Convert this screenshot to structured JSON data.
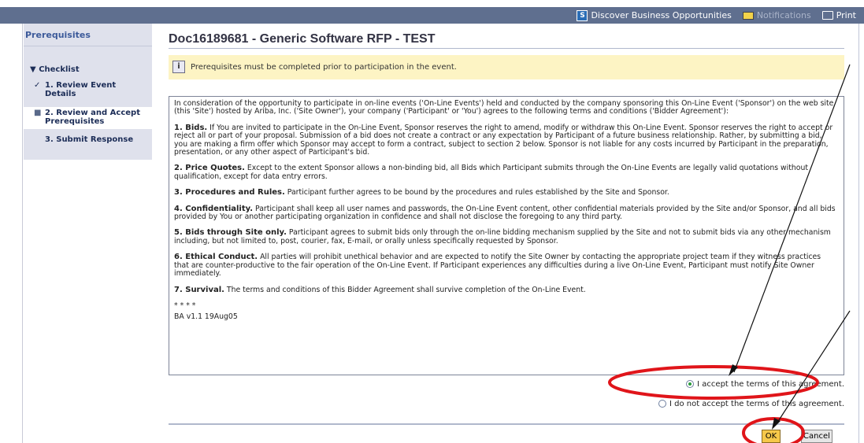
{
  "header": {
    "links": [
      {
        "icon": "business-icon",
        "label": "Discover Business Opportunities"
      },
      {
        "icon": "envelope-icon",
        "label": "Notifications"
      },
      {
        "icon": "printer-icon",
        "label": "Print"
      }
    ]
  },
  "sidebar": {
    "title": "Prerequisites",
    "checklist_label": "Checklist",
    "items": [
      {
        "mark": "✓",
        "label": "1. Review Event Details"
      },
      {
        "mark": "■",
        "label": "2. Review and Accept Prerequisites"
      },
      {
        "mark": "",
        "label": "3. Submit Response"
      }
    ]
  },
  "page": {
    "title": "Doc16189681 - Generic Software RFP - TEST",
    "notice": "Prerequisites must be completed prior to participation in the event."
  },
  "agreement": {
    "intro": "In consideration of the opportunity to participate in on-line events ('On-Line Events') held and conducted by the company sponsoring this On-Line Event ('Sponsor') on the web site (this 'Site') hosted by Ariba, Inc. ('Site Owner'), your company ('Participant' or 'You') agrees to the following terms and conditions ('Bidder Agreement'):",
    "sections": [
      {
        "heading": "1. Bids.",
        "text": "If You are invited to participate in the On-Line Event, Sponsor reserves the right to amend, modify or withdraw this On-Line Event.  Sponsor reserves the right to accept or reject all or part of your proposal.  Submission of a bid does not create a contract or any expectation by Participant of a future business relationship.  Rather, by submitting a bid, you are making a firm offer which Sponsor may accept to form a contract, subject to section 2 below.  Sponsor is not liable for any costs incurred by Participant in the preparation, presentation, or any other aspect of Participant's bid."
      },
      {
        "heading": "2. Price Quotes.",
        "text": "Except to the extent Sponsor allows a non-binding bid, all Bids which Participant submits through the On-Line Events are legally valid quotations without qualification, except for data entry errors."
      },
      {
        "heading": "3. Procedures and Rules.",
        "text": "Participant further agrees to be bound by the procedures and rules established by the Site and Sponsor."
      },
      {
        "heading": "4. Confidentiality.",
        "text": "Participant shall keep all user names and passwords, the On-Line Event content, other confidential materials provided by the Site and/or Sponsor, and all bids provided by You or another participating organization in confidence and shall not disclose the foregoing to any third party."
      },
      {
        "heading": "5. Bids through Site only.",
        "text": "Participant agrees to submit bids only through the on-line bidding mechanism supplied by the Site and not to submit bids via any other mechanism including, but not limited to, post, courier, fax, E-mail, or orally unless specifically requested by Sponsor."
      },
      {
        "heading": "6. Ethical Conduct.",
        "text": "All parties will prohibit unethical behavior and are expected to notify the Site Owner by contacting the appropriate project team if they witness practices that are counter-productive to the fair operation of the On-Line Event.  If Participant experiences any difficulties during a live On-Line Event, Participant must notify Site Owner immediately."
      },
      {
        "heading": "7. Survival.",
        "text": "The terms and conditions of this Bidder Agreement shall survive completion of the On-Line Event."
      }
    ],
    "stars": "* * * *",
    "version": "BA v1.1 19Aug05"
  },
  "options": {
    "accept": "I accept the terms of this agreement.",
    "decline": "I do not accept the terms of this agreement.",
    "selected": "accept"
  },
  "buttons": {
    "ok": "OK",
    "cancel": "Cancel"
  },
  "colors": {
    "nav": "#5f6f8f",
    "sidebar": "#dfe1ec",
    "notice": "#fdf4c4",
    "ok": "#f6c84a",
    "annotation": "#e0151a"
  }
}
